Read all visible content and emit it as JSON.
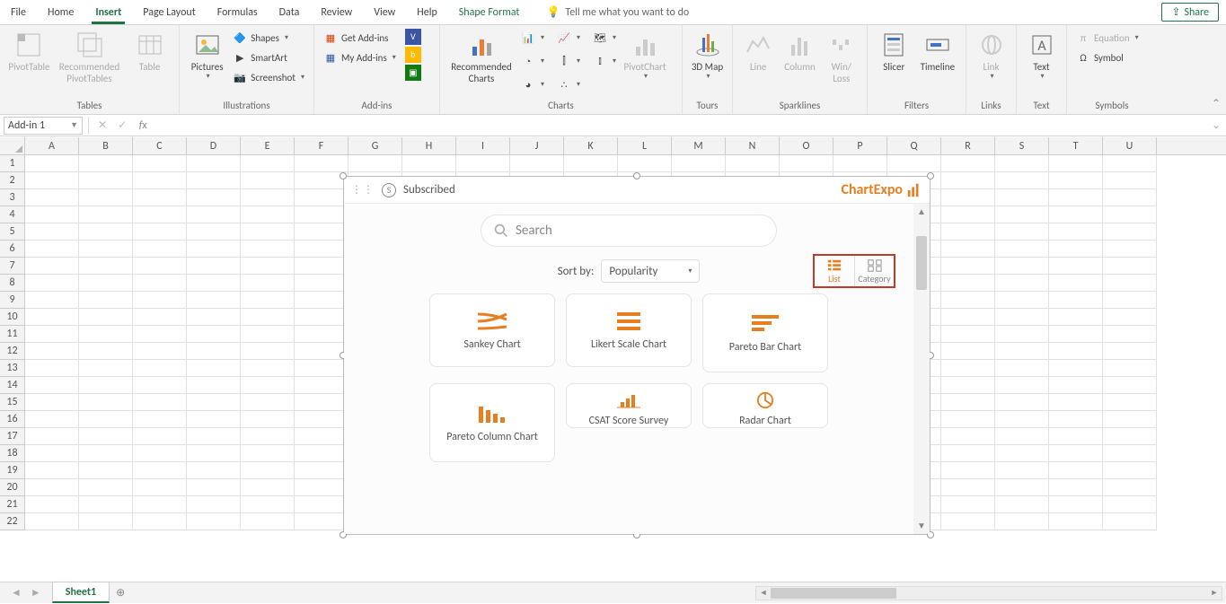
{
  "tabs": {
    "file": "File",
    "home": "Home",
    "insert": "Insert",
    "pagelayout": "Page Layout",
    "formulas": "Formulas",
    "data": "Data",
    "review": "Review",
    "view": "View",
    "help": "Help",
    "shapeformat": "Shape Format",
    "tellme": "Tell me what you want to do",
    "share": "Share"
  },
  "ribbon": {
    "tables": {
      "label": "Tables",
      "pivottable": "PivotTable",
      "recpivot": "Recommended PivotTables",
      "table": "Table"
    },
    "illustrations": {
      "label": "Illustrations",
      "pictures": "Pictures",
      "shapes": "Shapes",
      "smartart": "SmartArt",
      "screenshot": "Screenshot"
    },
    "addins": {
      "label": "Add-ins",
      "get": "Get Add-ins",
      "my": "My Add-ins"
    },
    "charts": {
      "label": "Charts",
      "recommended": "Recommended Charts",
      "pivot": "PivotChart"
    },
    "tours": {
      "label": "Tours",
      "map": "3D Map"
    },
    "sparklines": {
      "label": "Sparklines",
      "line": "Line",
      "column": "Column",
      "winloss": "Win/\nLoss"
    },
    "filters": {
      "label": "Filters",
      "slicer": "Slicer",
      "timeline": "Timeline"
    },
    "links": {
      "label": "Links",
      "link": "Link"
    },
    "text": {
      "label": "Text",
      "text": "Text"
    },
    "symbols": {
      "label": "Symbols",
      "equation": "Equation",
      "symbol": "Symbol"
    }
  },
  "namebox": "Add-in 1",
  "columns": [
    "A",
    "B",
    "C",
    "D",
    "E",
    "F",
    "G",
    "H",
    "I",
    "J",
    "K",
    "L",
    "M",
    "N",
    "O",
    "P",
    "Q",
    "R",
    "S",
    "T",
    "U"
  ],
  "rows": [
    1,
    2,
    3,
    4,
    5,
    6,
    7,
    8,
    9,
    10,
    11,
    12,
    13,
    14,
    15,
    16,
    17,
    18,
    19,
    20,
    21,
    22
  ],
  "addin": {
    "subscribed": "Subscribed",
    "brand": "ChartExpo",
    "search_placeholder": "Search",
    "sortby_label": "Sort by:",
    "sort_value": "Popularity",
    "view_list": "List",
    "view_category": "Category",
    "charts": [
      "Sankey Chart",
      "Likert Scale Chart",
      "Pareto Bar Chart",
      "Pareto Column Chart",
      "CSAT Score Survey",
      "Radar Chart"
    ]
  },
  "sheet": {
    "name": "Sheet1"
  }
}
